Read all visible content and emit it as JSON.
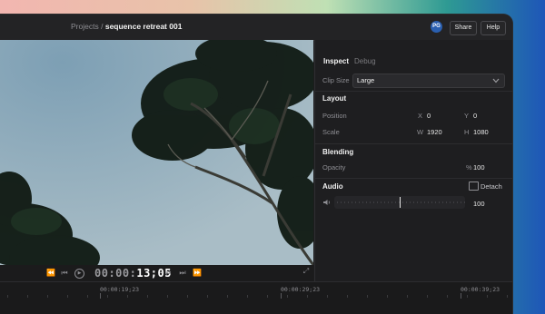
{
  "header": {
    "crumb_projects": "Projects",
    "crumb_sep": "/",
    "crumb_current": "sequence retreat 001",
    "avatar_initials": "PG",
    "share_label": "Share",
    "help_label": "Help"
  },
  "transport": {
    "timecode_prefix": "00:00:",
    "timecode_main": "13;05"
  },
  "panel": {
    "tabs": [
      "Inspect",
      "Debug"
    ],
    "clip_size_label": "Clip Size",
    "clip_size_value": "Large",
    "layout": {
      "title": "Layout",
      "position_label": "Position",
      "x_label": "X",
      "x_value": "0",
      "y_label": "Y",
      "y_value": "0",
      "scale_label": "Scale",
      "w_label": "W",
      "w_value": "1920",
      "h_label": "H",
      "h_value": "1080"
    },
    "blending": {
      "title": "Blending",
      "opacity_label": "Opacity",
      "opacity_unit": "%",
      "opacity_value": "100"
    },
    "audio": {
      "title": "Audio",
      "detach_label": "Detach",
      "volume_value": "100",
      "volume_level": 0.5
    }
  },
  "timeline": {
    "markers": [
      "00:00:19;23",
      "00:00:29;23",
      "00:00:39;23"
    ]
  },
  "colors": {
    "accent": "#2a5fb0",
    "panel_bg": "#1e1e20",
    "window_bg": "#1c1c1d"
  }
}
